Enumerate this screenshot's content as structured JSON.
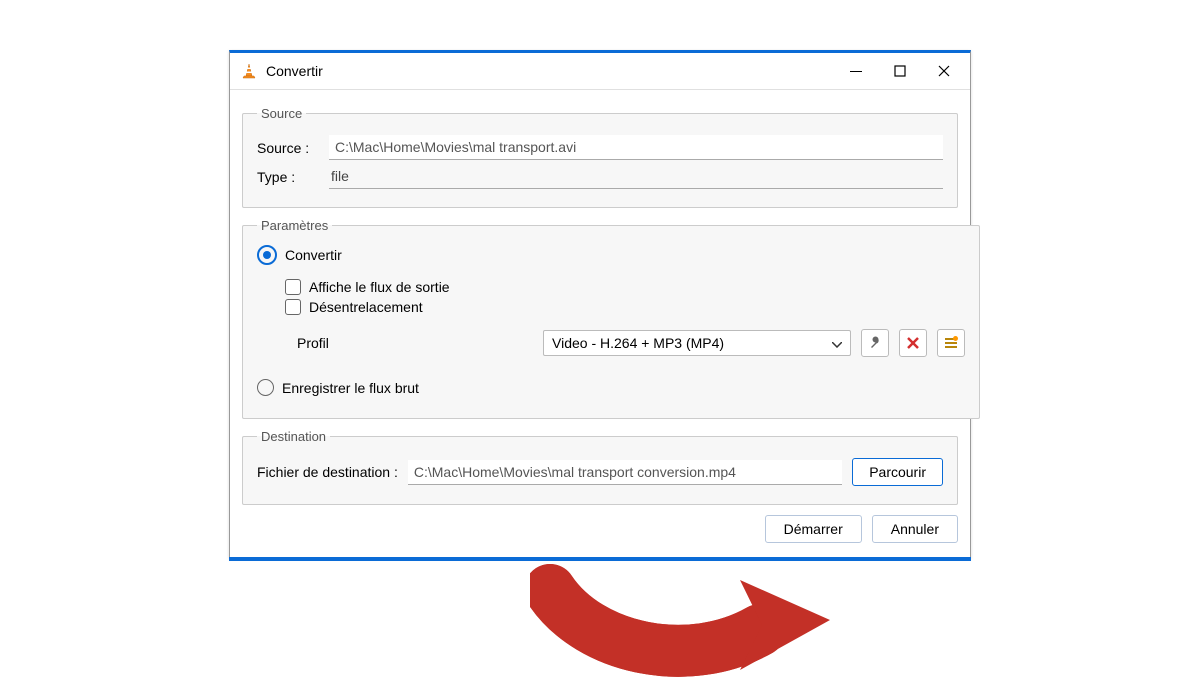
{
  "window": {
    "title": "Convertir"
  },
  "source": {
    "legend": "Source",
    "source_label": "Source :",
    "source_value": "C:\\Mac\\Home\\Movies\\mal transport.avi",
    "type_label": "Type :",
    "type_value": "file"
  },
  "params": {
    "legend": "Paramètres",
    "convert_label": "Convertir",
    "show_output_label": "Affiche le flux de sortie",
    "deinterlace_label": "Désentrelacement",
    "profile_label": "Profil",
    "profile_selected": "Video - H.264 + MP3 (MP4)",
    "raw_label": "Enregistrer le flux brut"
  },
  "destination": {
    "legend": "Destination",
    "dest_label": "Fichier de destination :",
    "dest_value": "C:\\Mac\\Home\\Movies\\mal transport conversion.mp4",
    "browse_label": "Parcourir"
  },
  "footer": {
    "start_label": "Démarrer",
    "cancel_label": "Annuler"
  }
}
